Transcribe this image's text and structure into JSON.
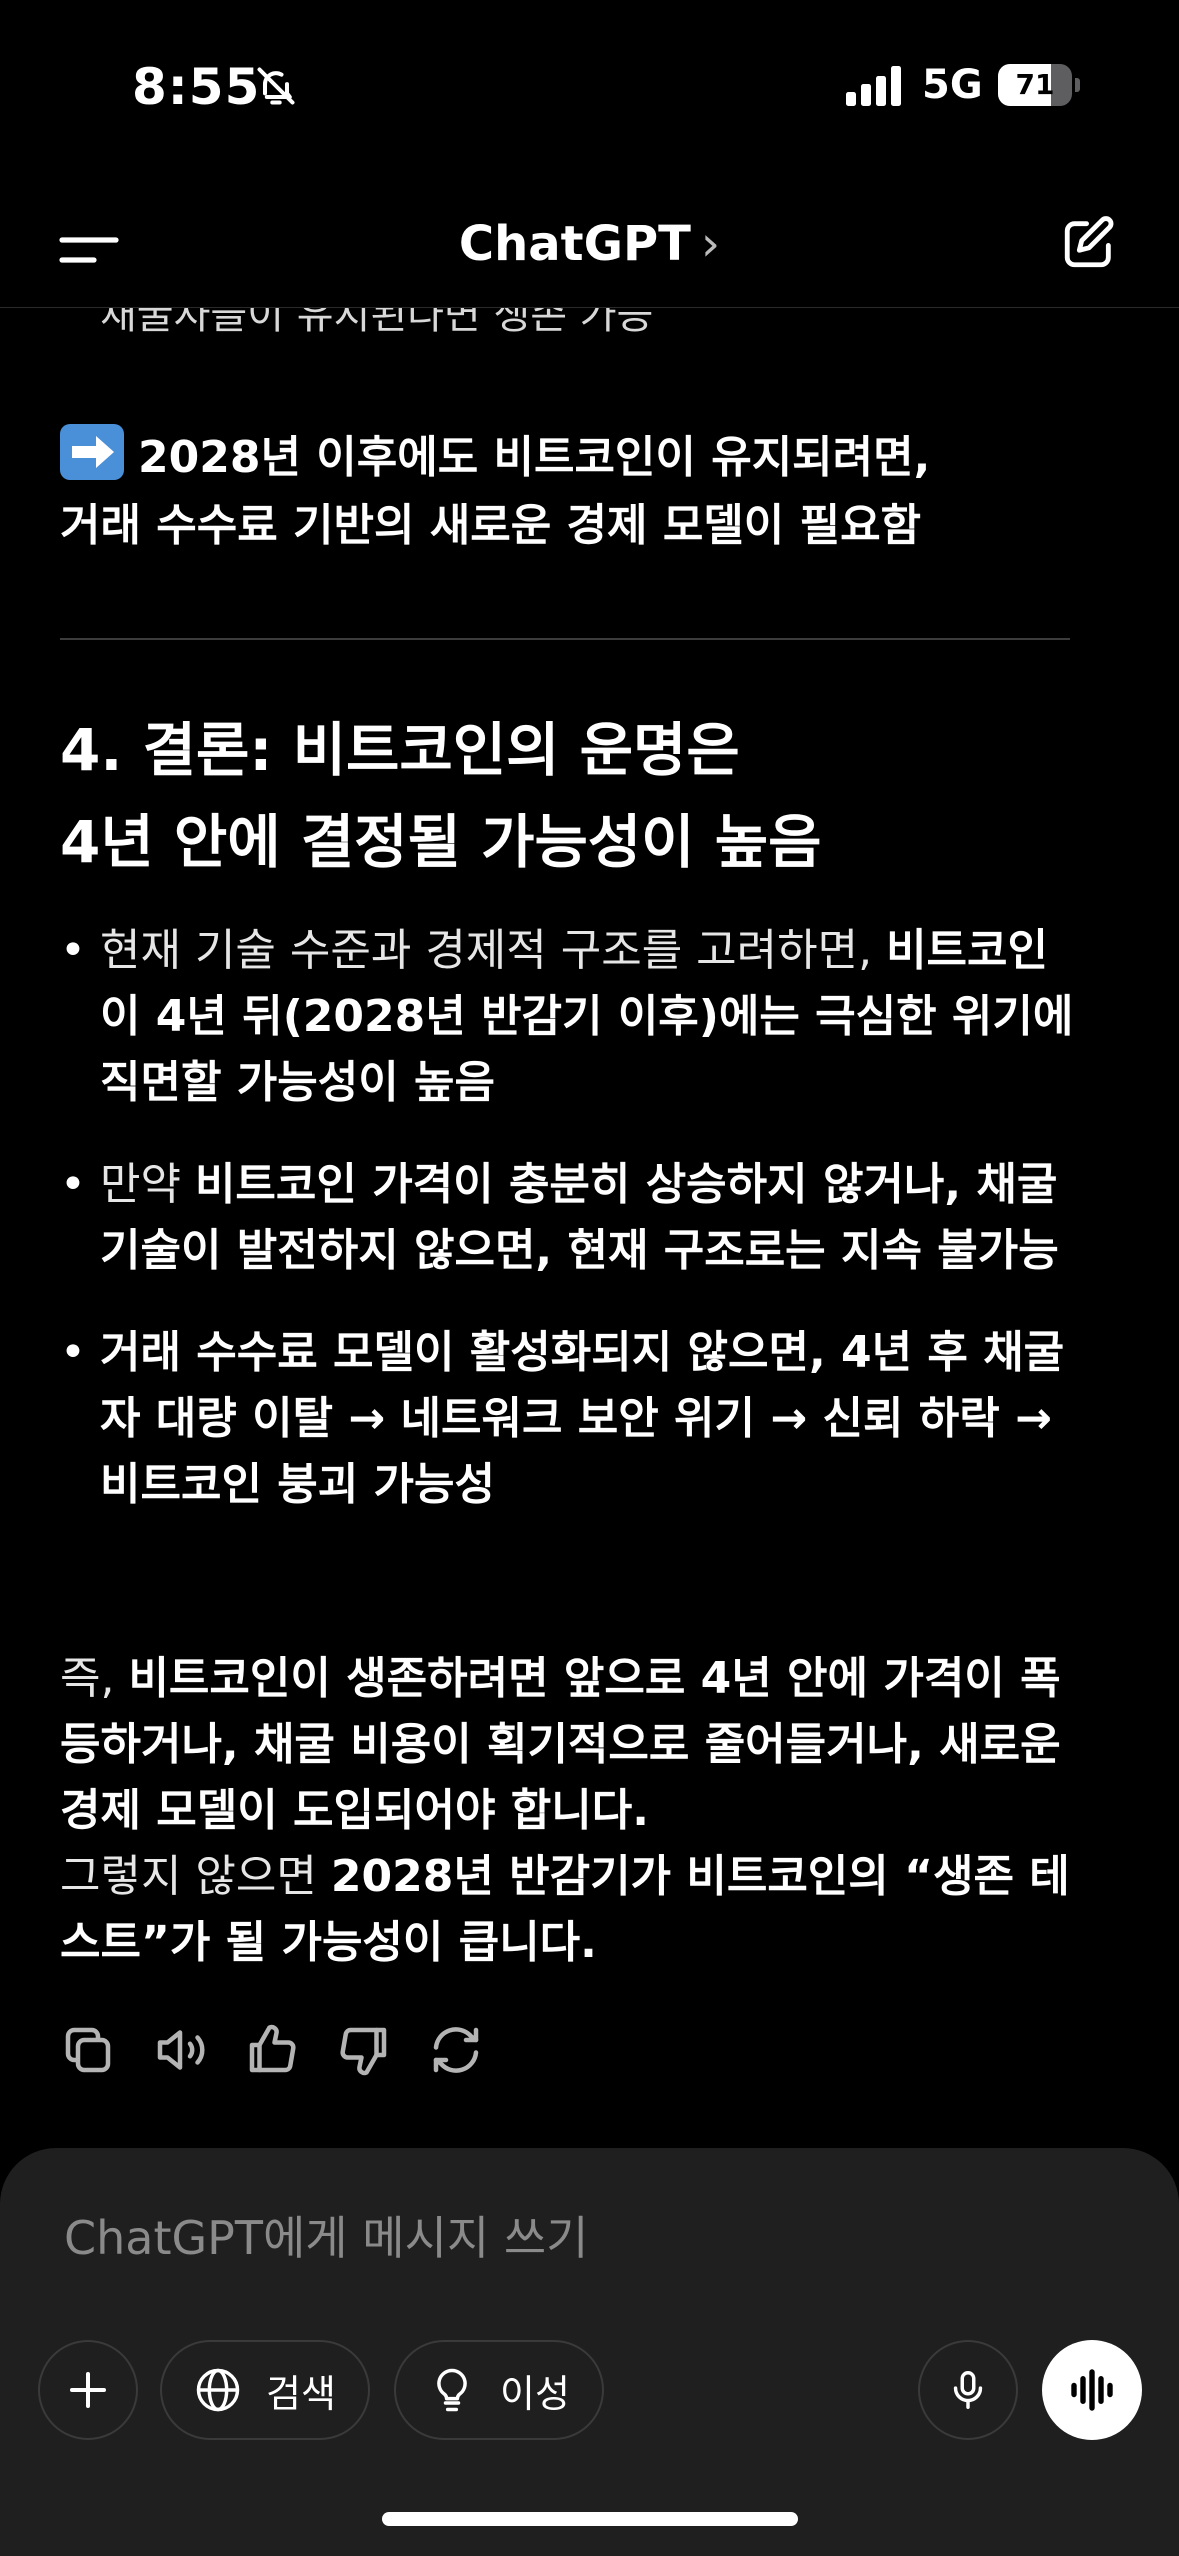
{
  "status_bar": {
    "time": "8:55",
    "network": "5G",
    "battery_level": 71,
    "battery_text": "71"
  },
  "header": {
    "title": "ChatGPT",
    "title_chevron": "›"
  },
  "message": {
    "cut_line": "채굴자들이 유지된다면 생존 가능",
    "conclusion_emoji": "arrow-right-emoji",
    "conclusion_line1": "2028년 이후에도 비트코인이 유지되려면,",
    "conclusion_line2": "거래 수수료 기반의 새로운 경제 모델이 필요함",
    "heading_line1": "4. 결론: 비트코인의 운명은",
    "heading_line2": "4년 안에 결정될 가능성이 높음",
    "bullets": [
      {
        "plain": "현재 기술 수준과 경제적 구조를 고려하면, ",
        "bold": "비트코인이 4년 뒤(2028년 반감기 이후)에는 극심한 위기에 직면할 가능성이 높음"
      },
      {
        "plain": "만약 ",
        "bold": "비트코인 가격이 충분히 상승하지 않거나, 채굴 기술이 발전하지 않으면, 현재 구조로는 지속 불가능"
      },
      {
        "plain": "",
        "bold": "거래 수수료 모델이 활성화되지 않으면, 4년 후 채굴자 대량 이탈 → 네트워크 보안 위기 → 신뢰 하락 → 비트코인 붕괴 가능성"
      }
    ],
    "summary_p1_plain": "즉, ",
    "summary_p1_bold": "비트코인이 생존하려면 앞으로 4년 안에 가격이 폭등하거나, 채굴 비용이 획기적으로 줄어들거나, 새로운 경제 모델이 도입되어야 합니다.",
    "summary_p2_plain": "그렇지 않으면 ",
    "summary_p2_bold": "2028년 반감기가 비트코인의 “생존 테스트”가 될 가능성이 큽니다."
  },
  "composer": {
    "placeholder": "ChatGPT에게 메시지 쓰기",
    "search_label": "검색",
    "reason_label": "이성"
  }
}
